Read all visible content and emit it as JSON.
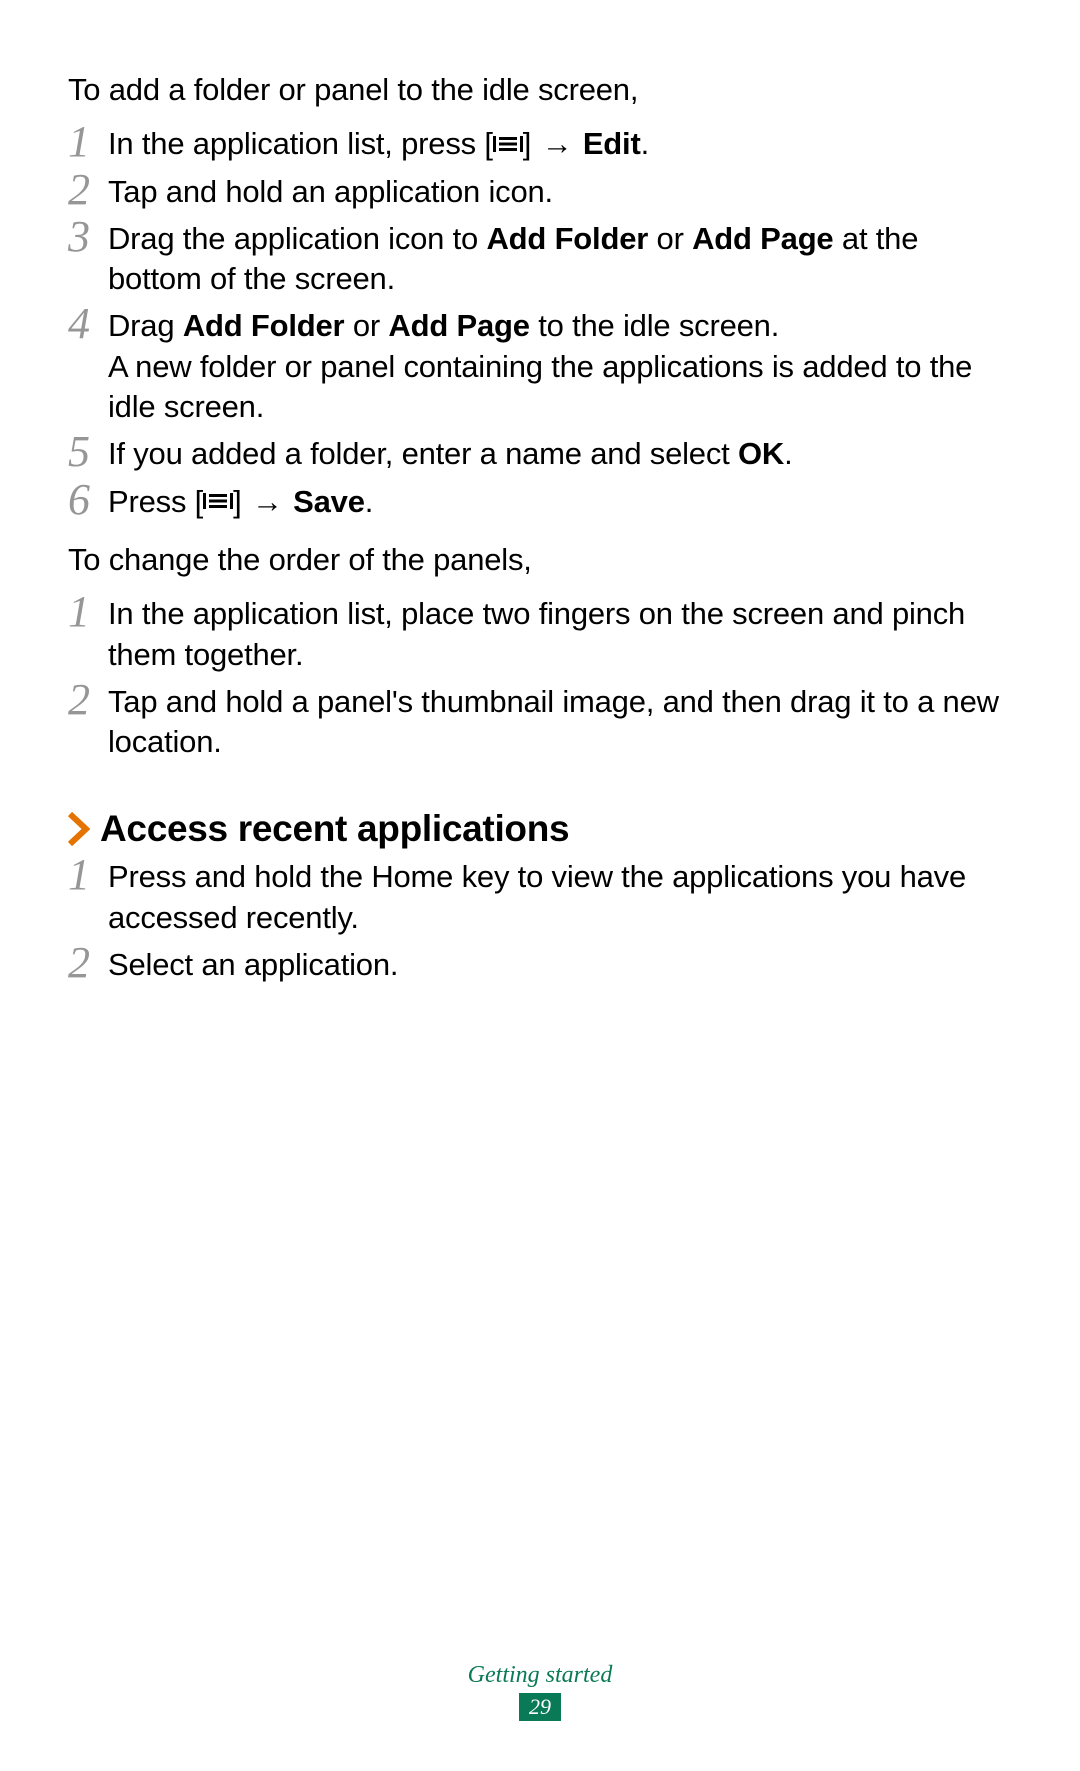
{
  "intro1": "To add a folder or panel to the idle screen,",
  "listA": [
    {
      "num": "1",
      "segments": [
        {
          "t": "In the application list, press ["
        },
        {
          "icon": "menu"
        },
        {
          "t": "] "
        },
        {
          "arrow": true
        },
        {
          "t": " "
        },
        {
          "t": "Edit",
          "b": true
        },
        {
          "t": "."
        }
      ]
    },
    {
      "num": "2",
      "segments": [
        {
          "t": "Tap and hold an application icon."
        }
      ]
    },
    {
      "num": "3",
      "segments": [
        {
          "t": "Drag the application icon to "
        },
        {
          "t": "Add Folder",
          "b": true
        },
        {
          "t": " or "
        },
        {
          "t": "Add Page",
          "b": true
        },
        {
          "t": " at the bottom of the screen."
        }
      ]
    },
    {
      "num": "4",
      "segments": [
        {
          "t": "Drag "
        },
        {
          "t": "Add Folder",
          "b": true
        },
        {
          "t": " or "
        },
        {
          "t": "Add Page",
          "b": true
        },
        {
          "t": " to the idle screen."
        },
        {
          "br": true
        },
        {
          "t": "A new folder or panel containing the applications is added to the idle screen."
        }
      ]
    },
    {
      "num": "5",
      "segments": [
        {
          "t": "If you added a folder, enter a name and select "
        },
        {
          "t": "OK",
          "b": true
        },
        {
          "t": "."
        }
      ]
    },
    {
      "num": "6",
      "segments": [
        {
          "t": "Press ["
        },
        {
          "icon": "menu"
        },
        {
          "t": "] "
        },
        {
          "arrow": true
        },
        {
          "t": " "
        },
        {
          "t": "Save",
          "b": true
        },
        {
          "t": "."
        }
      ]
    }
  ],
  "intro2": "To change the order of the panels,",
  "listB": [
    {
      "num": "1",
      "segments": [
        {
          "t": "In the application list, place two fingers on the screen and pinch them together."
        }
      ]
    },
    {
      "num": "2",
      "segments": [
        {
          "t": "Tap and hold a panel's thumbnail image, and then drag it to a new location."
        }
      ]
    }
  ],
  "heading": "Access recent applications",
  "listC": [
    {
      "num": "1",
      "segments": [
        {
          "t": "Press and hold the Home key to view the applications you have accessed recently."
        }
      ]
    },
    {
      "num": "2",
      "segments": [
        {
          "t": "Select an application."
        }
      ]
    }
  ],
  "footer_label": "Getting started",
  "page_number": "29"
}
